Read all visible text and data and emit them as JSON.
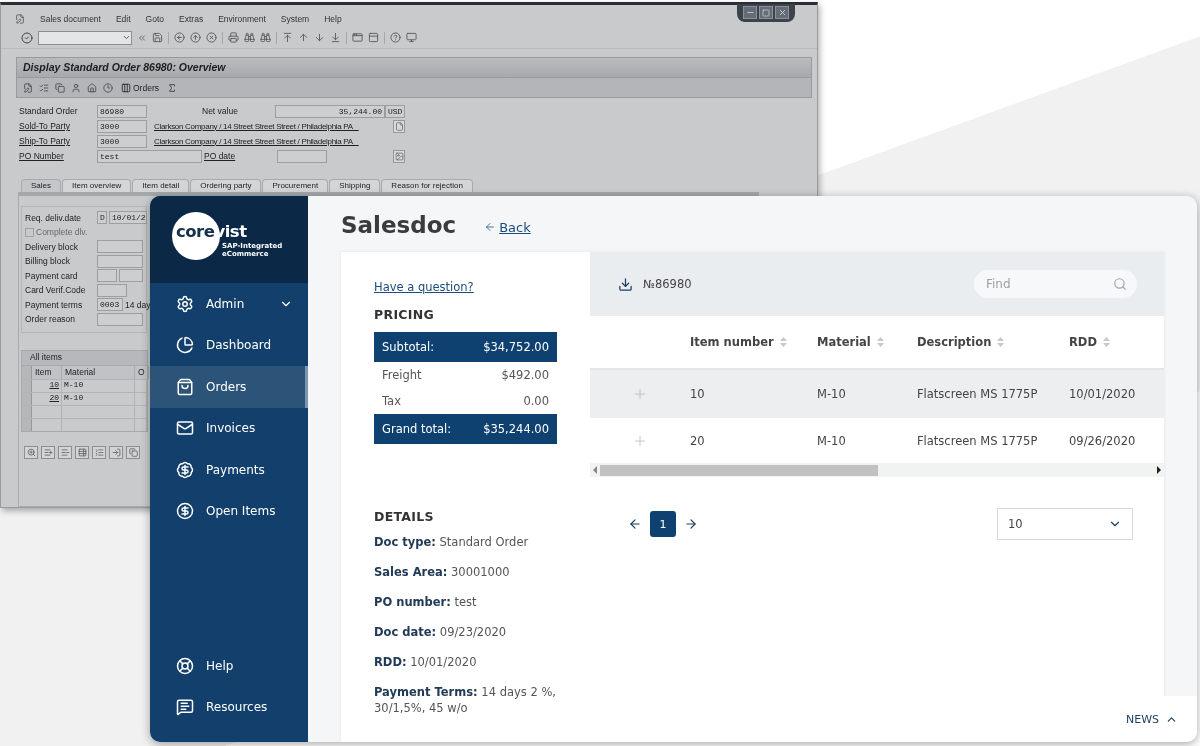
{
  "sap_window": {
    "menu": [
      "Sales document",
      "Edit",
      "Goto",
      "Extras",
      "Environment",
      "System",
      "Help"
    ],
    "title": "Display Standard Order 86980: Overview",
    "toolbar_button": "Orders",
    "header": [
      {
        "kind": "amount",
        "label": "Standard Order",
        "value": "86980",
        "label_2": "Net value",
        "value_2": "35,244.00",
        "unit": "USD"
      },
      {
        "kind": "party",
        "label": "Sold-To Party",
        "value": "3000",
        "description": "Clarkson Company / 14 Street Street Street / Philadelphia PA _"
      },
      {
        "kind": "party",
        "label": "Ship-To Party",
        "value": "3000",
        "description": "Clarkson Company / 14 Street Street Street / Philadelphia PA _"
      },
      {
        "kind": "po",
        "label": "PO Number",
        "value": "test",
        "label_2": "PO date"
      }
    ],
    "tabs": [
      {
        "label": "Sales",
        "selected": true
      },
      {
        "label": "Item overview",
        "selected": false
      },
      {
        "label": "Item detail",
        "selected": false
      },
      {
        "label": "Ordering party",
        "selected": false
      },
      {
        "label": "Procurement",
        "selected": false
      },
      {
        "label": "Shipping",
        "selected": false
      },
      {
        "label": "Reason for rejection",
        "selected": false
      }
    ],
    "sales_fields": [
      {
        "kind": "field",
        "label": "Req. deliv.date",
        "code": "D",
        "value": "10/01/2"
      },
      {
        "kind": "checkbox",
        "label": "Complete dlv.",
        "checked": false,
        "disabled": true
      },
      {
        "kind": "field",
        "label": "Delivery block"
      },
      {
        "kind": "field",
        "label": "Billing block"
      },
      {
        "kind": "card",
        "label": "Payment card"
      },
      {
        "kind": "short",
        "label": "Card Verif.Code"
      },
      {
        "kind": "field",
        "label": "Payment terms",
        "code": "0003",
        "value": "14 day"
      },
      {
        "kind": "field",
        "label": "Order reason"
      }
    ],
    "items_table": {
      "title": "All items",
      "columns": [
        "Item",
        "Material",
        "O"
      ],
      "rows": [
        {
          "item": "10",
          "material": "M-10"
        },
        {
          "item": "20",
          "material": "M-10"
        }
      ]
    }
  },
  "app": {
    "logo": {
      "name_parts": [
        "core",
        "vist"
      ],
      "tagline": "SAP-Integrated eCommerce"
    },
    "nav": [
      {
        "label": "Admin",
        "kind": "group",
        "selected": false
      },
      {
        "label": "Dashboard",
        "kind": "link",
        "selected": false
      },
      {
        "label": "Orders",
        "kind": "link",
        "selected": true
      },
      {
        "label": "Invoices",
        "kind": "link",
        "selected": false
      },
      {
        "label": "Payments",
        "kind": "link",
        "selected": false
      },
      {
        "label": "Open Items",
        "kind": "link",
        "selected": false
      }
    ],
    "bottom_nav": [
      {
        "label": "Help"
      },
      {
        "label": "Resources"
      }
    ],
    "page": {
      "title": "Salesdoc",
      "back": "Back"
    },
    "question_link": "Have a question?",
    "pricing": {
      "heading": "PRICING",
      "rows": [
        {
          "kind": "total",
          "label": "Subtotal:",
          "value": "$34,752.00"
        },
        {
          "kind": "line",
          "label": "Freight",
          "value": "$492.00"
        },
        {
          "kind": "line",
          "label": "Tax",
          "value": "0.00"
        },
        {
          "kind": "total",
          "label": "Grand total:",
          "value": "$35,244.00"
        }
      ]
    },
    "details": {
      "heading": "DETAILS",
      "items": [
        "**Doc type:** Standard Order",
        "**Sales Area:** 30001000",
        "**PO number:** test",
        "**Doc date:** 09/23/2020",
        "**RDD:** 10/01/2020",
        "**Payment Terms:** 14 days 2 %, 30/1,5%, 45 w/o"
      ]
    },
    "document": {
      "number": "№86980",
      "search_placeholder": "Find"
    },
    "table": {
      "columns": [
        "Item number",
        "Material",
        "Description",
        "RDD"
      ],
      "rows": [
        {
          "cells": [
            "10",
            "M-10",
            "Flatscreen MS 1775P",
            "10/01/2020"
          ],
          "hovered": true
        },
        {
          "cells": [
            "20",
            "M-10",
            "Flatscreen MS 1775P",
            "09/26/2020"
          ],
          "hovered": false
        }
      ]
    },
    "pagination": {
      "pages": [
        {
          "label": "1",
          "selected": true
        }
      ],
      "page_size": "10"
    },
    "news": "NEWS"
  }
}
